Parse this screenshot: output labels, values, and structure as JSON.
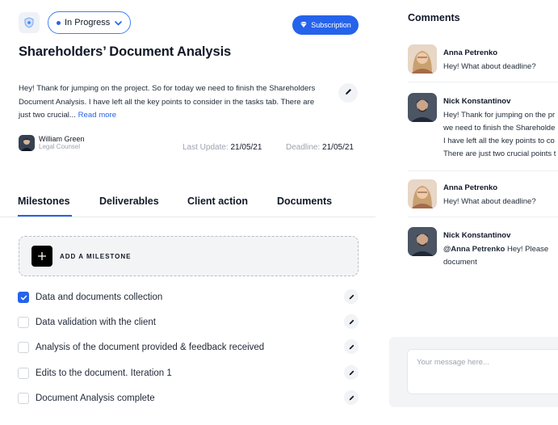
{
  "header": {
    "status": "In Progress",
    "subscription_label": "Subscription",
    "title": "Shareholders’ Document Analysis",
    "description": "Hey! Thank for jumping on the project. So for today we need to finish the Shareholders Document Analysis. I have left all the key points to consider in the tasks tab. There are just two crucial...",
    "read_more": "Read more"
  },
  "owner": {
    "name": "William Green",
    "role": "Legal Counsel"
  },
  "dates": {
    "last_update_label": "Last Update:",
    "last_update": "21/05/21",
    "deadline_label": "Deadline:",
    "deadline": "21/05/21"
  },
  "tabs": [
    {
      "label": "Milestones",
      "active": true
    },
    {
      "label": "Deliverables",
      "active": false
    },
    {
      "label": "Client action",
      "active": false
    },
    {
      "label": "Documents",
      "active": false
    }
  ],
  "add_milestone_label": "ADD A MILESTONE",
  "milestones": [
    {
      "label": "Data and documents collection",
      "checked": true
    },
    {
      "label": "Data validation with the client",
      "checked": false
    },
    {
      "label": "Analysis of the document provided & feedback received",
      "checked": false
    },
    {
      "label": "Edits to the document. Iteration 1",
      "checked": false
    },
    {
      "label": "Document Analysis complete",
      "checked": false
    }
  ],
  "comments": {
    "title": "Comments",
    "items": [
      {
        "author": "Anna Petrenko",
        "lines": [
          "Hey! What about deadline?"
        ]
      },
      {
        "author": "Nick Konstantinov",
        "lines": [
          "Hey! Thank for jumping on the pr",
          "we need to finish the Shareholde",
          "I have left all the key points to co",
          "There are just two crucial points t"
        ]
      },
      {
        "author": "Anna Petrenko",
        "lines": [
          "Hey! What about deadline?"
        ]
      },
      {
        "author": "Nick Konstantinov",
        "mention": "@Anna Petrenko",
        "lines": [
          " Hey! Please",
          "document"
        ]
      }
    ],
    "input_placeholder": "Your message here..."
  },
  "colors": {
    "accent": "#2563eb",
    "text": "#111827",
    "muted": "#9ca3af"
  }
}
